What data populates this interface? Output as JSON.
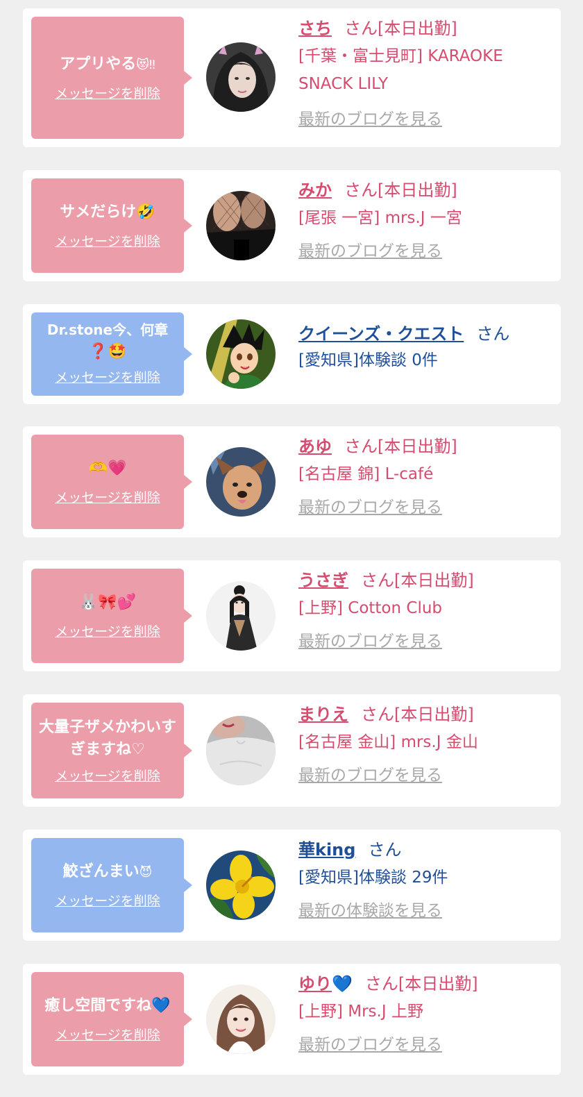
{
  "delete_label": "メッセージを削除",
  "colors": {
    "pink_bubble": "#ec9daa",
    "blue_bubble": "#94b7ef",
    "pink_text": "#d64b6e",
    "blue_text": "#1f4f9b",
    "muted_link": "#a8a8a8",
    "background": "#efefef"
  },
  "cards": [
    {
      "variant": "pink",
      "message": "アプリやる",
      "message_emoji": "😻‼",
      "name": "さち",
      "name_emoji": "",
      "suffix": "さん[本日出勤]",
      "shop": "[千葉・富士見町] KARAOKE SNACK LILY",
      "link": "最新のブログを見る",
      "avatar_icon": "avatar-woman-hair-photo"
    },
    {
      "variant": "pink",
      "message": "サメだらけ",
      "message_emoji": "🤣",
      "name": "みか",
      "name_emoji": "",
      "suffix": "さん[本日出勤]",
      "shop": "[尾張 一宮] mrs.J 一宮",
      "link": "最新のブログを見る",
      "avatar_icon": "avatar-legs-photo"
    },
    {
      "variant": "blue",
      "message": "Dr.stone今、何章",
      "message_emoji": "❓🤩",
      "name": "クイーンズ・クエスト",
      "name_emoji": "",
      "suffix": "さん",
      "shop": "[愛知県]体験談 0件",
      "link": "",
      "avatar_icon": "avatar-anime-boy"
    },
    {
      "variant": "pink",
      "message": "",
      "message_emoji": "🫶💗",
      "name": "あゆ",
      "name_emoji": "",
      "suffix": "さん[本日出勤]",
      "shop": "[名古屋 錦] L-café",
      "link": "最新のブログを見る",
      "avatar_icon": "avatar-dog-filter-photo"
    },
    {
      "variant": "pink",
      "message": "",
      "message_emoji": "🐰🎀💕",
      "name": "うさぎ",
      "name_emoji": "",
      "suffix": "さん[本日出勤]",
      "shop": "[上野] Cotton Club",
      "link": "最新のブログを見る",
      "avatar_icon": "avatar-kimono-girl-photo"
    },
    {
      "variant": "pink",
      "message": "大量子ザメかわいすぎますね♡",
      "message_emoji": "",
      "name": "まりえ",
      "name_emoji": "",
      "suffix": "さん[本日出勤]",
      "shop": "[名古屋 金山] mrs.J 金山",
      "link": "最新のブログを見る",
      "avatar_icon": "avatar-white-top-photo"
    },
    {
      "variant": "blue",
      "message": "鮫ざんまい",
      "message_emoji": "😈",
      "name": "華king",
      "name_emoji": "",
      "suffix": "さん",
      "shop": "[愛知県]体験談 29件",
      "link": "最新の体験談を見る",
      "avatar_icon": "avatar-yellow-flower"
    },
    {
      "variant": "pink",
      "message": "癒し空間ですね",
      "message_emoji": "💙",
      "name": "ゆり",
      "name_emoji": "💙",
      "suffix": "さん[本日出勤]",
      "shop": "[上野] Mrs.J 上野",
      "link": "最新のブログを見る",
      "avatar_icon": "avatar-smiling-woman-photo"
    }
  ]
}
